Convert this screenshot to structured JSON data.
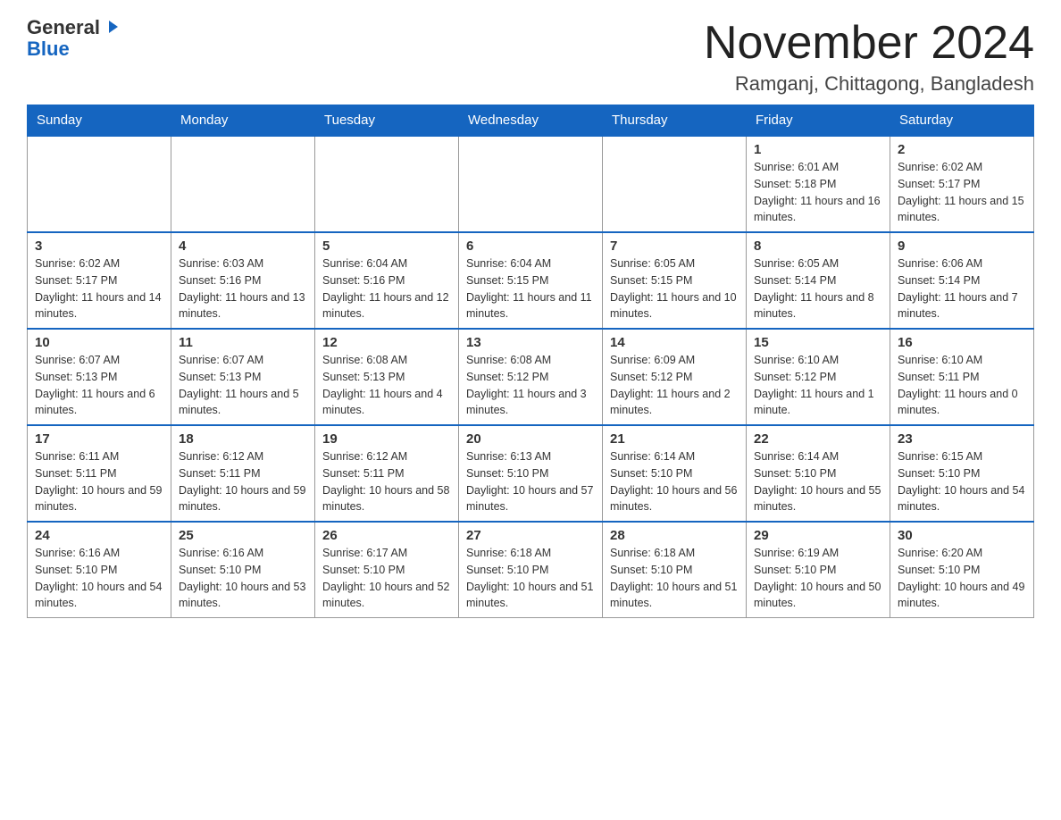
{
  "logo": {
    "general": "General",
    "blue": "Blue",
    "arrow": "▶"
  },
  "header": {
    "month_year": "November 2024",
    "location": "Ramganj, Chittagong, Bangladesh"
  },
  "days_of_week": [
    "Sunday",
    "Monday",
    "Tuesday",
    "Wednesday",
    "Thursday",
    "Friday",
    "Saturday"
  ],
  "weeks": [
    [
      {
        "day": "",
        "sunrise": "",
        "sunset": "",
        "daylight": ""
      },
      {
        "day": "",
        "sunrise": "",
        "sunset": "",
        "daylight": ""
      },
      {
        "day": "",
        "sunrise": "",
        "sunset": "",
        "daylight": ""
      },
      {
        "day": "",
        "sunrise": "",
        "sunset": "",
        "daylight": ""
      },
      {
        "day": "",
        "sunrise": "",
        "sunset": "",
        "daylight": ""
      },
      {
        "day": "1",
        "sunrise": "Sunrise: 6:01 AM",
        "sunset": "Sunset: 5:18 PM",
        "daylight": "Daylight: 11 hours and 16 minutes."
      },
      {
        "day": "2",
        "sunrise": "Sunrise: 6:02 AM",
        "sunset": "Sunset: 5:17 PM",
        "daylight": "Daylight: 11 hours and 15 minutes."
      }
    ],
    [
      {
        "day": "3",
        "sunrise": "Sunrise: 6:02 AM",
        "sunset": "Sunset: 5:17 PM",
        "daylight": "Daylight: 11 hours and 14 minutes."
      },
      {
        "day": "4",
        "sunrise": "Sunrise: 6:03 AM",
        "sunset": "Sunset: 5:16 PM",
        "daylight": "Daylight: 11 hours and 13 minutes."
      },
      {
        "day": "5",
        "sunrise": "Sunrise: 6:04 AM",
        "sunset": "Sunset: 5:16 PM",
        "daylight": "Daylight: 11 hours and 12 minutes."
      },
      {
        "day": "6",
        "sunrise": "Sunrise: 6:04 AM",
        "sunset": "Sunset: 5:15 PM",
        "daylight": "Daylight: 11 hours and 11 minutes."
      },
      {
        "day": "7",
        "sunrise": "Sunrise: 6:05 AM",
        "sunset": "Sunset: 5:15 PM",
        "daylight": "Daylight: 11 hours and 10 minutes."
      },
      {
        "day": "8",
        "sunrise": "Sunrise: 6:05 AM",
        "sunset": "Sunset: 5:14 PM",
        "daylight": "Daylight: 11 hours and 8 minutes."
      },
      {
        "day": "9",
        "sunrise": "Sunrise: 6:06 AM",
        "sunset": "Sunset: 5:14 PM",
        "daylight": "Daylight: 11 hours and 7 minutes."
      }
    ],
    [
      {
        "day": "10",
        "sunrise": "Sunrise: 6:07 AM",
        "sunset": "Sunset: 5:13 PM",
        "daylight": "Daylight: 11 hours and 6 minutes."
      },
      {
        "day": "11",
        "sunrise": "Sunrise: 6:07 AM",
        "sunset": "Sunset: 5:13 PM",
        "daylight": "Daylight: 11 hours and 5 minutes."
      },
      {
        "day": "12",
        "sunrise": "Sunrise: 6:08 AM",
        "sunset": "Sunset: 5:13 PM",
        "daylight": "Daylight: 11 hours and 4 minutes."
      },
      {
        "day": "13",
        "sunrise": "Sunrise: 6:08 AM",
        "sunset": "Sunset: 5:12 PM",
        "daylight": "Daylight: 11 hours and 3 minutes."
      },
      {
        "day": "14",
        "sunrise": "Sunrise: 6:09 AM",
        "sunset": "Sunset: 5:12 PM",
        "daylight": "Daylight: 11 hours and 2 minutes."
      },
      {
        "day": "15",
        "sunrise": "Sunrise: 6:10 AM",
        "sunset": "Sunset: 5:12 PM",
        "daylight": "Daylight: 11 hours and 1 minute."
      },
      {
        "day": "16",
        "sunrise": "Sunrise: 6:10 AM",
        "sunset": "Sunset: 5:11 PM",
        "daylight": "Daylight: 11 hours and 0 minutes."
      }
    ],
    [
      {
        "day": "17",
        "sunrise": "Sunrise: 6:11 AM",
        "sunset": "Sunset: 5:11 PM",
        "daylight": "Daylight: 10 hours and 59 minutes."
      },
      {
        "day": "18",
        "sunrise": "Sunrise: 6:12 AM",
        "sunset": "Sunset: 5:11 PM",
        "daylight": "Daylight: 10 hours and 59 minutes."
      },
      {
        "day": "19",
        "sunrise": "Sunrise: 6:12 AM",
        "sunset": "Sunset: 5:11 PM",
        "daylight": "Daylight: 10 hours and 58 minutes."
      },
      {
        "day": "20",
        "sunrise": "Sunrise: 6:13 AM",
        "sunset": "Sunset: 5:10 PM",
        "daylight": "Daylight: 10 hours and 57 minutes."
      },
      {
        "day": "21",
        "sunrise": "Sunrise: 6:14 AM",
        "sunset": "Sunset: 5:10 PM",
        "daylight": "Daylight: 10 hours and 56 minutes."
      },
      {
        "day": "22",
        "sunrise": "Sunrise: 6:14 AM",
        "sunset": "Sunset: 5:10 PM",
        "daylight": "Daylight: 10 hours and 55 minutes."
      },
      {
        "day": "23",
        "sunrise": "Sunrise: 6:15 AM",
        "sunset": "Sunset: 5:10 PM",
        "daylight": "Daylight: 10 hours and 54 minutes."
      }
    ],
    [
      {
        "day": "24",
        "sunrise": "Sunrise: 6:16 AM",
        "sunset": "Sunset: 5:10 PM",
        "daylight": "Daylight: 10 hours and 54 minutes."
      },
      {
        "day": "25",
        "sunrise": "Sunrise: 6:16 AM",
        "sunset": "Sunset: 5:10 PM",
        "daylight": "Daylight: 10 hours and 53 minutes."
      },
      {
        "day": "26",
        "sunrise": "Sunrise: 6:17 AM",
        "sunset": "Sunset: 5:10 PM",
        "daylight": "Daylight: 10 hours and 52 minutes."
      },
      {
        "day": "27",
        "sunrise": "Sunrise: 6:18 AM",
        "sunset": "Sunset: 5:10 PM",
        "daylight": "Daylight: 10 hours and 51 minutes."
      },
      {
        "day": "28",
        "sunrise": "Sunrise: 6:18 AM",
        "sunset": "Sunset: 5:10 PM",
        "daylight": "Daylight: 10 hours and 51 minutes."
      },
      {
        "day": "29",
        "sunrise": "Sunrise: 6:19 AM",
        "sunset": "Sunset: 5:10 PM",
        "daylight": "Daylight: 10 hours and 50 minutes."
      },
      {
        "day": "30",
        "sunrise": "Sunrise: 6:20 AM",
        "sunset": "Sunset: 5:10 PM",
        "daylight": "Daylight: 10 hours and 49 minutes."
      }
    ]
  ]
}
